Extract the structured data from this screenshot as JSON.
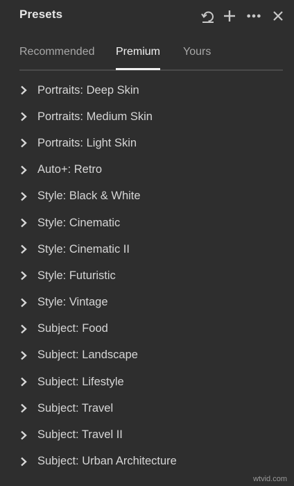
{
  "panel": {
    "title": "Presets"
  },
  "header_icons": {
    "reset": "undo-icon",
    "add": "plus-icon",
    "more": "more-icon",
    "close": "close-icon"
  },
  "tabs": [
    {
      "label": "Recommended",
      "active": false
    },
    {
      "label": "Premium",
      "active": true
    },
    {
      "label": "Yours",
      "active": false
    }
  ],
  "presets": [
    {
      "label": "Portraits: Deep Skin"
    },
    {
      "label": "Portraits: Medium Skin"
    },
    {
      "label": "Portraits: Light Skin"
    },
    {
      "label": "Auto+: Retro"
    },
    {
      "label": "Style: Black & White"
    },
    {
      "label": "Style: Cinematic"
    },
    {
      "label": "Style: Cinematic II"
    },
    {
      "label": "Style: Futuristic"
    },
    {
      "label": "Style: Vintage"
    },
    {
      "label": "Subject: Food"
    },
    {
      "label": "Subject: Landscape"
    },
    {
      "label": "Subject: Lifestyle"
    },
    {
      "label": "Subject: Travel"
    },
    {
      "label": "Subject: Travel II"
    },
    {
      "label": "Subject: Urban Architecture"
    }
  ],
  "colors": {
    "background": "#2e2e2e",
    "text": "#d6d6d6",
    "active_tab": "#f2f2f2",
    "inactive_tab": "#a8a8a8"
  },
  "watermark": "wtvid.com"
}
